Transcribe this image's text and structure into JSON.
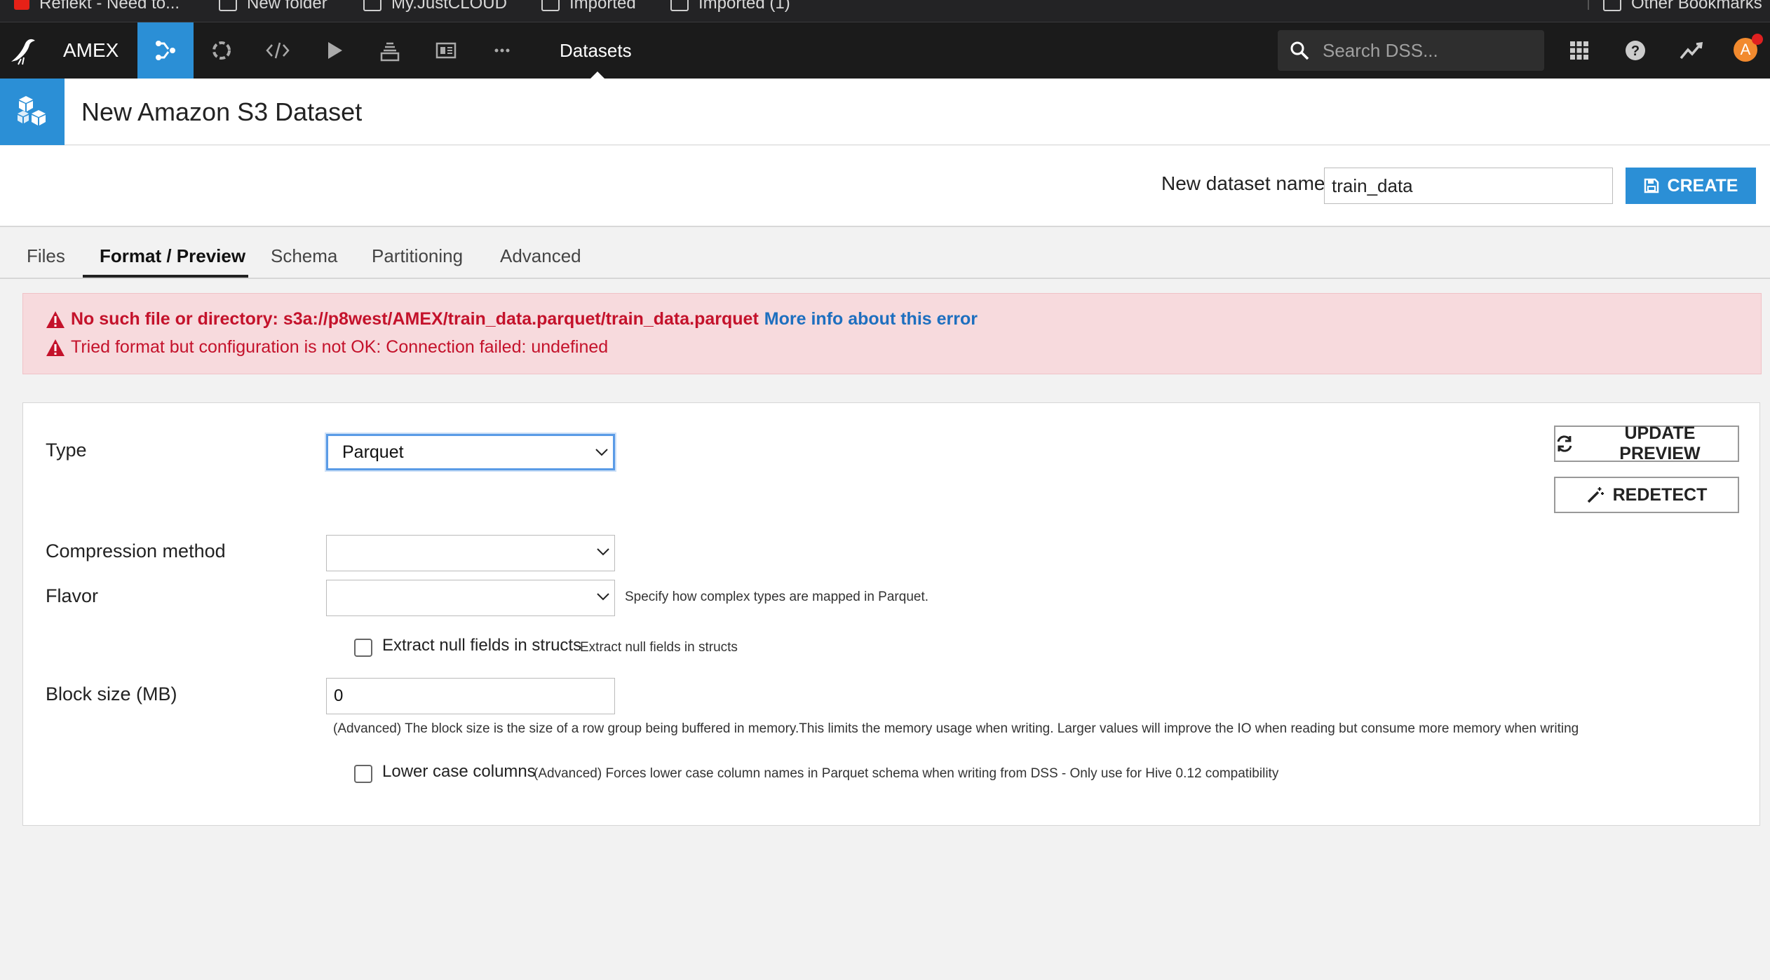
{
  "browser": {
    "bookmarks": [
      {
        "label": "Reflekt - Need to...",
        "icon": "youtube-icon"
      },
      {
        "label": "New folder",
        "icon": "folder-icon"
      },
      {
        "label": "My.JustCLOUD",
        "icon": "folder-icon"
      },
      {
        "label": "Imported",
        "icon": "folder-icon"
      },
      {
        "label": "Imported (1)",
        "icon": "folder-icon"
      }
    ],
    "other_bookmarks": "Other Bookmarks"
  },
  "header": {
    "project": "AMEX",
    "section": "Datasets",
    "search_placeholder": "Search DSS...",
    "avatar_initial": "A",
    "accent": "#2b8fd6",
    "nav_icons": [
      "flow-icon",
      "recipes-icon",
      "code-icon",
      "run-icon",
      "deploy-icon",
      "dashboard-icon",
      "more-icon"
    ],
    "right_icons": [
      "apps-grid-icon",
      "help-icon",
      "activity-icon"
    ]
  },
  "page": {
    "title": "New Amazon S3 Dataset"
  },
  "name_row": {
    "label": "New dataset name",
    "value": "train_data",
    "create_label": "CREATE"
  },
  "tabs": [
    "Files",
    "Format / Preview",
    "Schema",
    "Partitioning",
    "Advanced"
  ],
  "active_tab": "Format / Preview",
  "errors": {
    "line1": "No such file or directory: s3a://p8west/AMEX/train_data.parquet/train_data.parquet",
    "link": "More info about this error",
    "line2": "Tried format but configuration is not OK: Connection failed: undefined",
    "color": "#c4122b"
  },
  "form": {
    "type_label": "Type",
    "type_value": "Parquet",
    "compression_label": "Compression method",
    "compression_value": "",
    "flavor_label": "Flavor",
    "flavor_value": "",
    "flavor_hint": "Specify how complex types are mapped in Parquet.",
    "extract_null_label": "Extract null fields in structs",
    "extract_null_hint": "Extract null fields in structs",
    "block_size_label": "Block size (MB)",
    "block_size_value": "0",
    "block_size_hint": "(Advanced) The block size is the size of a row group being buffered in memory.This limits the memory usage when writing. Larger values will improve the IO when reading but consume more memory when writing",
    "lower_case_label": "Lower case columns",
    "lower_case_hint": "(Advanced) Forces lower case column names in Parquet schema when writing from DSS - Only use for Hive 0.12 compatibility",
    "update_preview_label": "UPDATE PREVIEW",
    "redetect_label": "REDETECT"
  }
}
